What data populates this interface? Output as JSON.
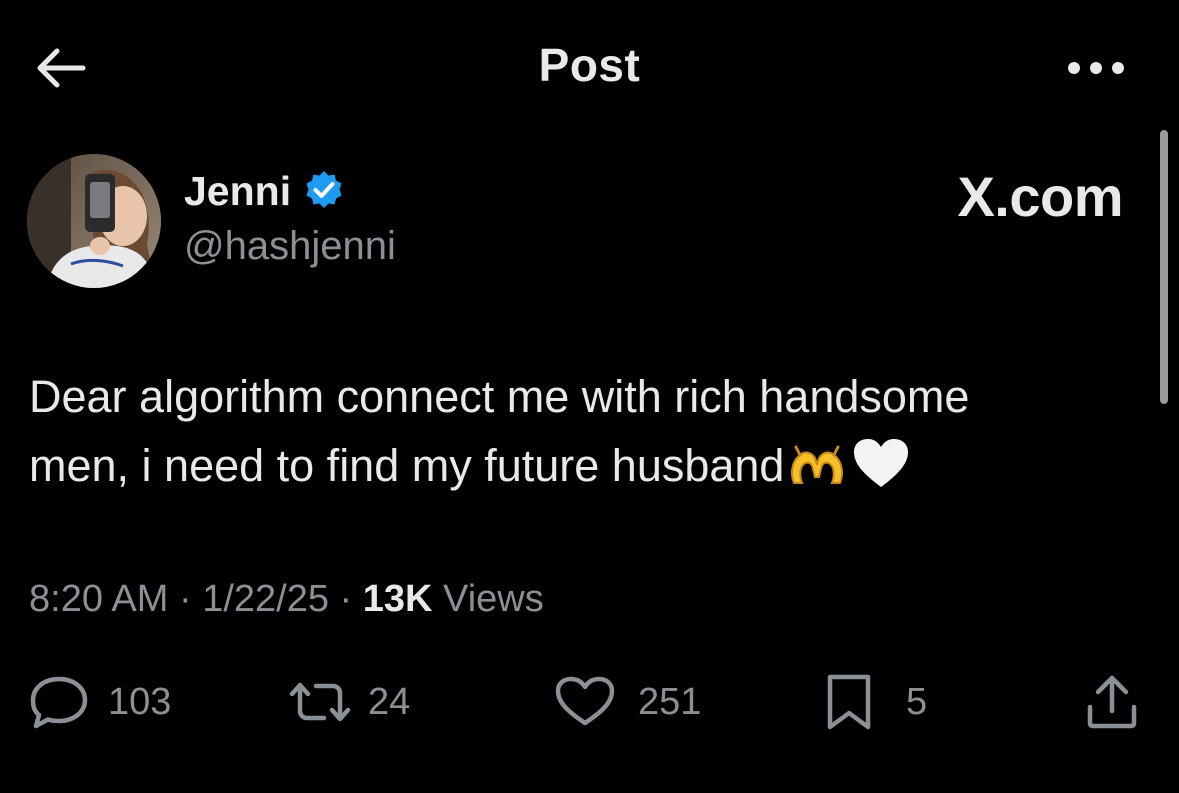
{
  "header": {
    "title": "Post"
  },
  "author": {
    "name": "Jenni",
    "handle": "@hashjenni",
    "verified": true
  },
  "brand": "X.com",
  "tweet": {
    "line1": "Dear algorithm connect me with rich handsome",
    "line2": "men, i need to find my future husband",
    "emojis": [
      "heart-hands",
      "white-heart"
    ]
  },
  "meta": {
    "time": "8:20 AM",
    "sep1": " · ",
    "date": "1/22/25",
    "sep2": " · ",
    "views_count": "13K",
    "views_label": " Views"
  },
  "actions": {
    "replies": "103",
    "reposts": "24",
    "likes": "251",
    "bookmarks": "5"
  },
  "colors": {
    "background": "#000000",
    "text": "#e7e9ea",
    "secondary": "#8b9096",
    "verified": "#1d9bf0"
  }
}
